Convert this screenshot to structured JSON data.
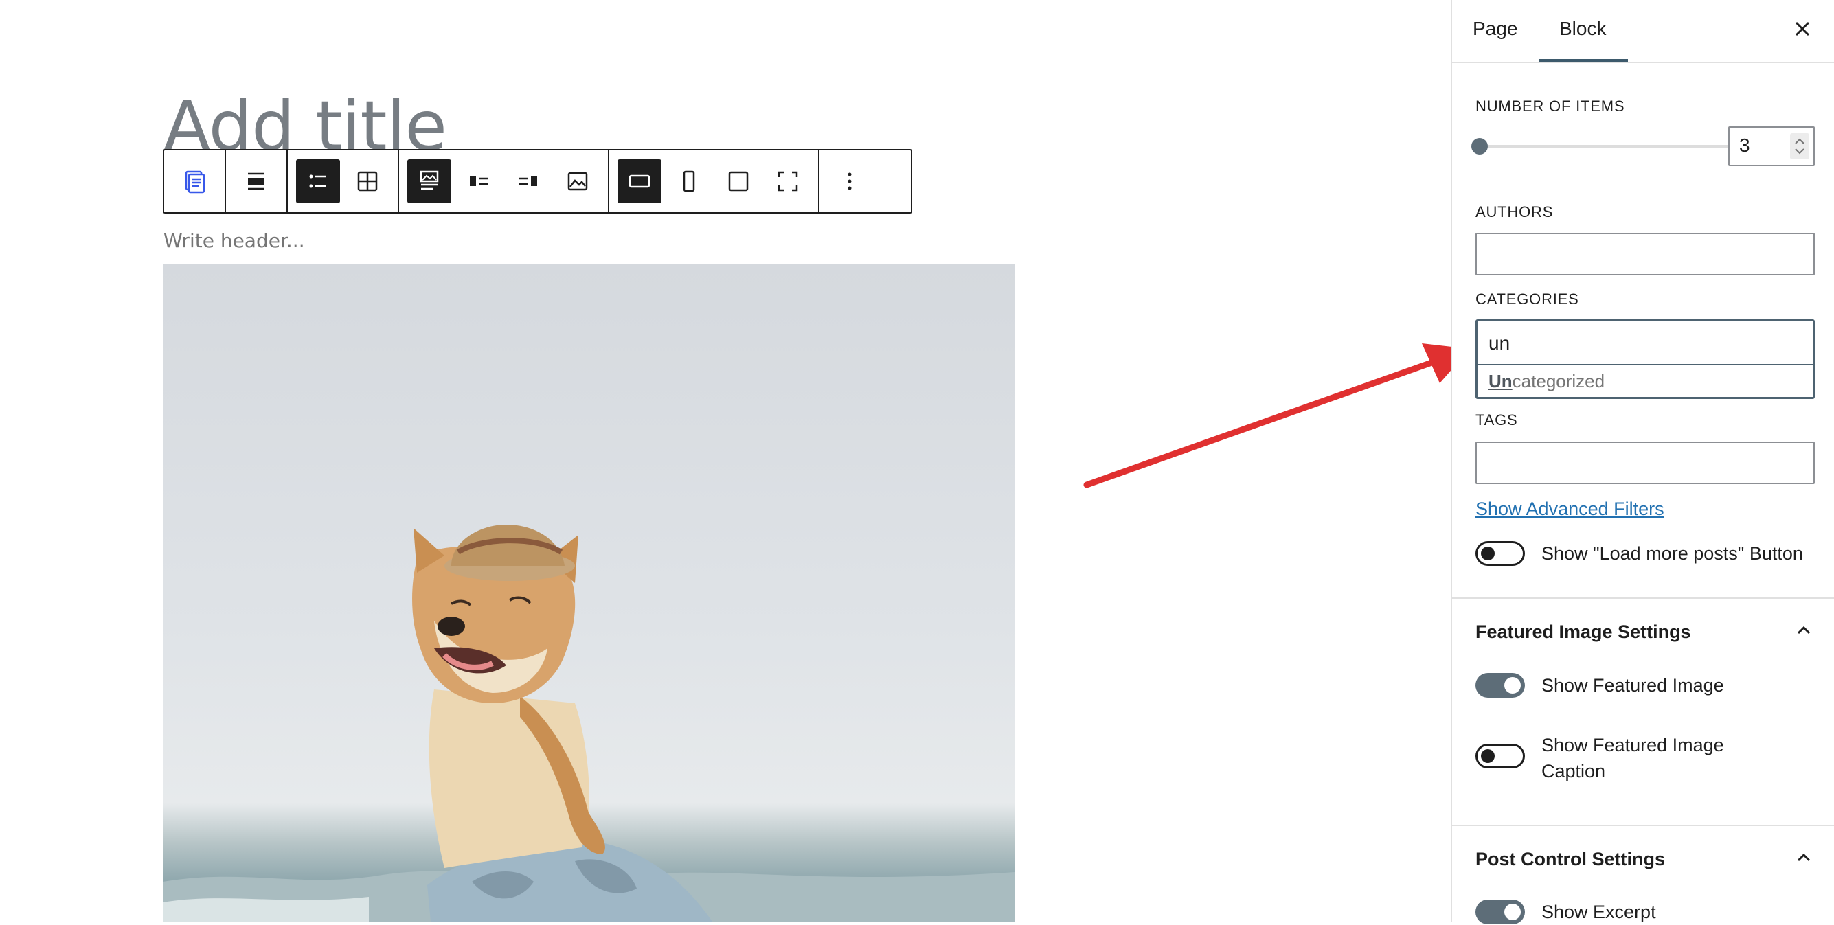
{
  "editor": {
    "title_placeholder": "Add title",
    "header_placeholder": "Write header...",
    "toolbar_icons": [
      "block-type-icon",
      "align-icon",
      "list-view-icon",
      "grid-view-icon",
      "image-top-icon",
      "image-left-icon",
      "image-right-icon",
      "image-behind-icon",
      "landscape-icon",
      "portrait-icon",
      "square-icon",
      "uncropped-icon",
      "more-options-icon"
    ]
  },
  "sidebar": {
    "tabs": {
      "page": "Page",
      "block": "Block"
    },
    "number_of_items": {
      "label": "NUMBER OF ITEMS",
      "value": "3",
      "slider_fraction": 0.0
    },
    "authors": {
      "label": "AUTHORS",
      "value": ""
    },
    "categories": {
      "label": "CATEGORIES",
      "value": "un",
      "suggestion_match": "Un",
      "suggestion_rest": "categorized"
    },
    "tags": {
      "label": "TAGS",
      "value": ""
    },
    "advanced_link": "Show Advanced Filters",
    "load_more": {
      "label": "Show \"Load more posts\" Button",
      "on": false
    },
    "featured_image_section": {
      "title": "Featured Image Settings",
      "show_image": {
        "label": "Show Featured Image",
        "on": true
      },
      "show_caption": {
        "label": "Show Featured Image Caption",
        "on": false
      }
    },
    "post_control_section": {
      "title": "Post Control Settings",
      "show_excerpt": {
        "label": "Show Excerpt",
        "on": true
      }
    }
  },
  "colors": {
    "accent": "#3d5a6c",
    "link": "#2271b1",
    "arrow": "#e03030"
  }
}
